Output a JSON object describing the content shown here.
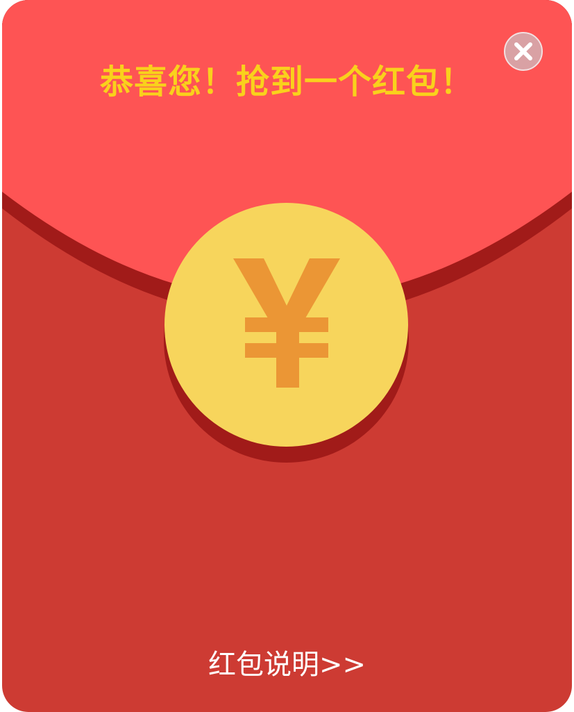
{
  "dialog": {
    "title": "恭喜您！抢到一个红包！",
    "close_icon": "close-icon",
    "coin_icon": "yuan-icon",
    "footer_link": "红包说明>>"
  },
  "colors": {
    "flap": "#fe5454",
    "body": "#cd3b33",
    "shadow": "#a11b19",
    "coin": "#f7d55c",
    "yuan_symbol": "#eb9635",
    "title": "#f9d11c",
    "close_x": "#ffffff"
  }
}
